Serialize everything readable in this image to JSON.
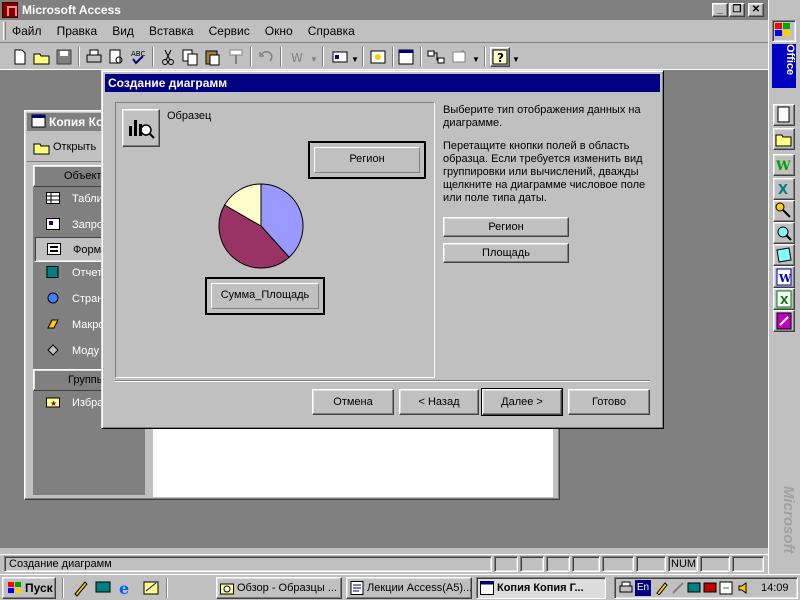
{
  "app": {
    "title": "Microsoft Access"
  },
  "menu": [
    "Файл",
    "Правка",
    "Вид",
    "Вставка",
    "Сервис",
    "Окно",
    "Справка"
  ],
  "db_window": {
    "title": "Копия Ко",
    "open_label": "Открыть",
    "objects_header": "Объект",
    "items": [
      "Табли",
      "Запро",
      "Форм",
      "Отчет",
      "Стран",
      "Макро",
      "Моду"
    ],
    "groups_header": "Группы",
    "favorites": "Избра"
  },
  "dialog": {
    "title": "Создание диаграмм",
    "sample_label": "Образец",
    "instruction_1": "Выберите тип отображения данных на диаграмме.",
    "instruction_2": "Перетащите кнопки полей в область образца. Если требуется изменить вид группировки или вычислений, дважды щелкните на диаграмме числовое поле или поле типа даты.",
    "series_field": "Регион",
    "data_field": "Сумма_Площадь",
    "field_buttons": [
      "Регион",
      "Площадь"
    ],
    "buttons": {
      "cancel": "Отмена",
      "back": "< Назад",
      "next": "Далее >",
      "finish": "Готово"
    },
    "chart_colors": [
      "#9999ff",
      "#993366",
      "#ffffcc"
    ]
  },
  "status": {
    "text": "Создание диаграмм",
    "num": "NUM"
  },
  "office_bar": {
    "label": "Office",
    "brand": "Microsoft"
  },
  "taskbar": {
    "start": "Пуск",
    "tasks": [
      "Обзор - Образцы ...",
      "Лекции Access(A5)...",
      "Копия Копия Г..."
    ],
    "tray_lang": "En",
    "clock": "14:09"
  }
}
